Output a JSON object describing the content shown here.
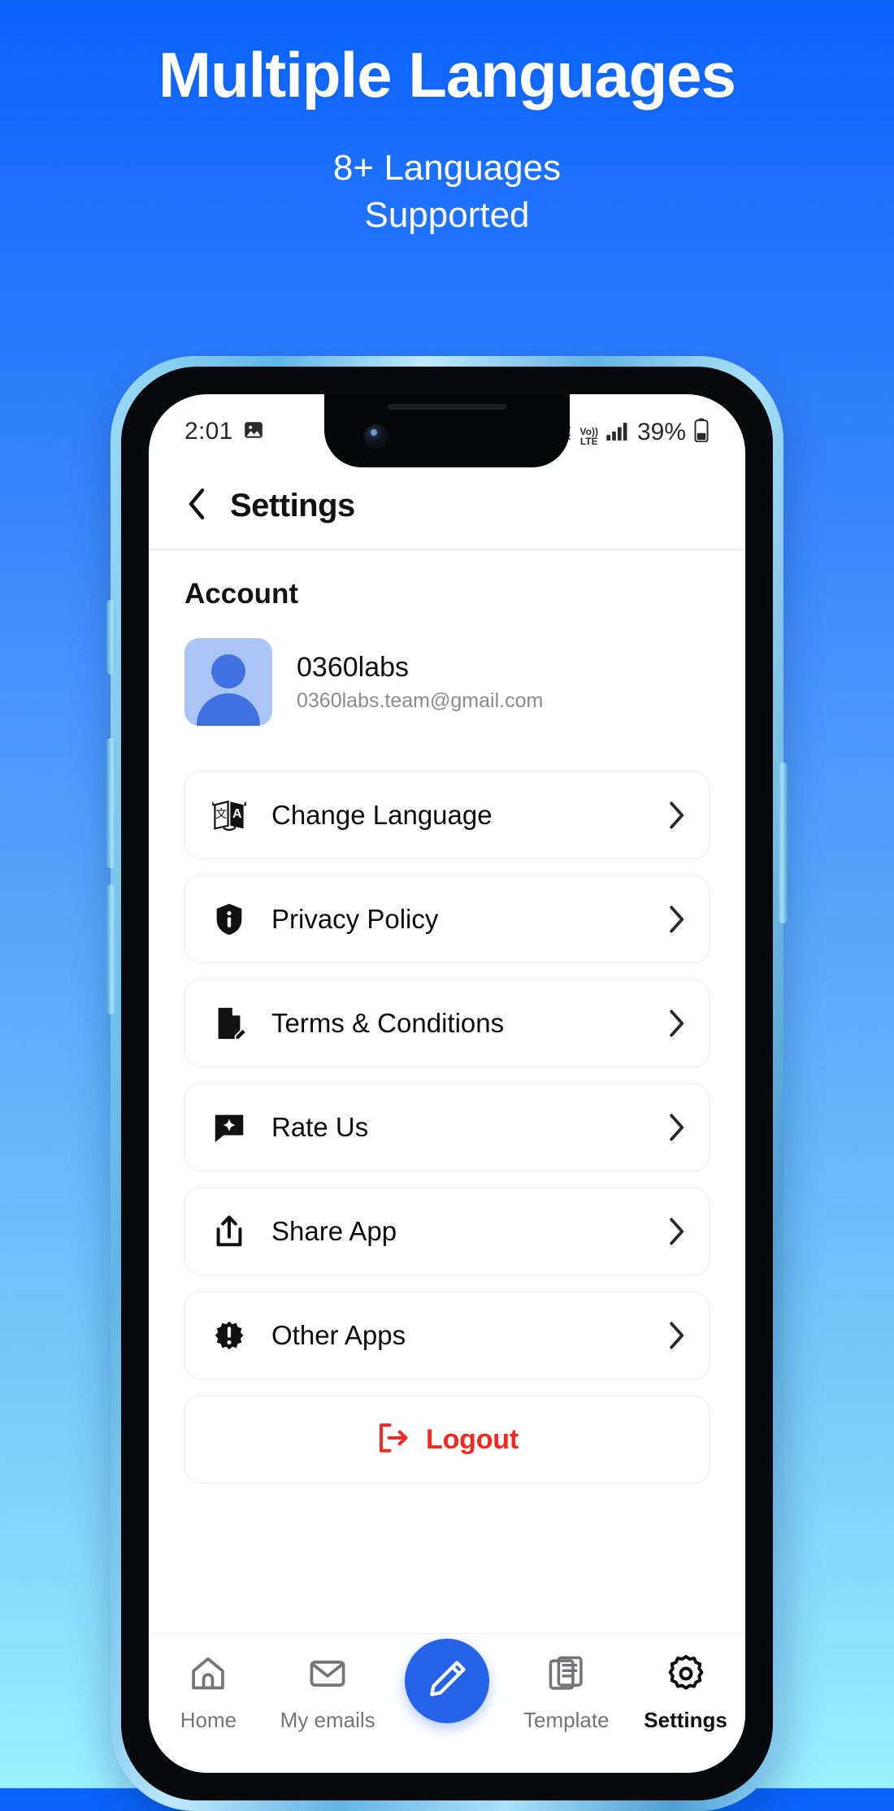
{
  "promo": {
    "title": "Multiple Languages",
    "subtitle_line1": "8+ Languages",
    "subtitle_line2": "Supported"
  },
  "colors": {
    "bg_top": "#0a63fb",
    "bg_bottom": "#9cf0ff",
    "accent": "#2563e8",
    "danger": "#f3281e",
    "avatar_bg": "#a9c4f5",
    "muted_text": "#8b8b8f"
  },
  "status_bar": {
    "time": "2:01",
    "image_icon": "image-icon",
    "wifi_icon": "wifi-icon",
    "volte_top": "Vo))",
    "volte_bottom": "LTE",
    "signal_icon": "cellular-signal-icon",
    "battery_percent": "39%",
    "battery_icon": "battery-icon"
  },
  "app_header": {
    "back_icon": "back-chevron-icon",
    "title": "Settings"
  },
  "account": {
    "section_title": "Account",
    "avatar_icon": "person-avatar-icon",
    "name": "0360labs",
    "email": "0360labs.team@gmail.com"
  },
  "menu": {
    "items": [
      {
        "label": "Change Language",
        "icon": "translate-icon"
      },
      {
        "label": "Privacy Policy",
        "icon": "shield-info-icon"
      },
      {
        "label": "Terms & Conditions",
        "icon": "document-edit-icon"
      },
      {
        "label": "Rate Us",
        "icon": "chat-star-icon"
      },
      {
        "label": "Share App",
        "icon": "share-icon"
      },
      {
        "label": "Other Apps",
        "icon": "badge-exclamation-icon"
      }
    ],
    "chevron_icon": "chevron-right-icon"
  },
  "logout": {
    "label": "Logout",
    "icon": "logout-arrow-icon"
  },
  "bottom_nav": {
    "items": [
      {
        "label": "Home",
        "icon": "home-icon",
        "active": false
      },
      {
        "label": "My emails",
        "icon": "envelope-icon",
        "active": false
      },
      {
        "label": "Template",
        "icon": "document-list-icon",
        "active": false
      },
      {
        "label": "Settings",
        "icon": "gear-icon",
        "active": true
      }
    ],
    "fab": {
      "icon": "pencil-icon"
    }
  }
}
